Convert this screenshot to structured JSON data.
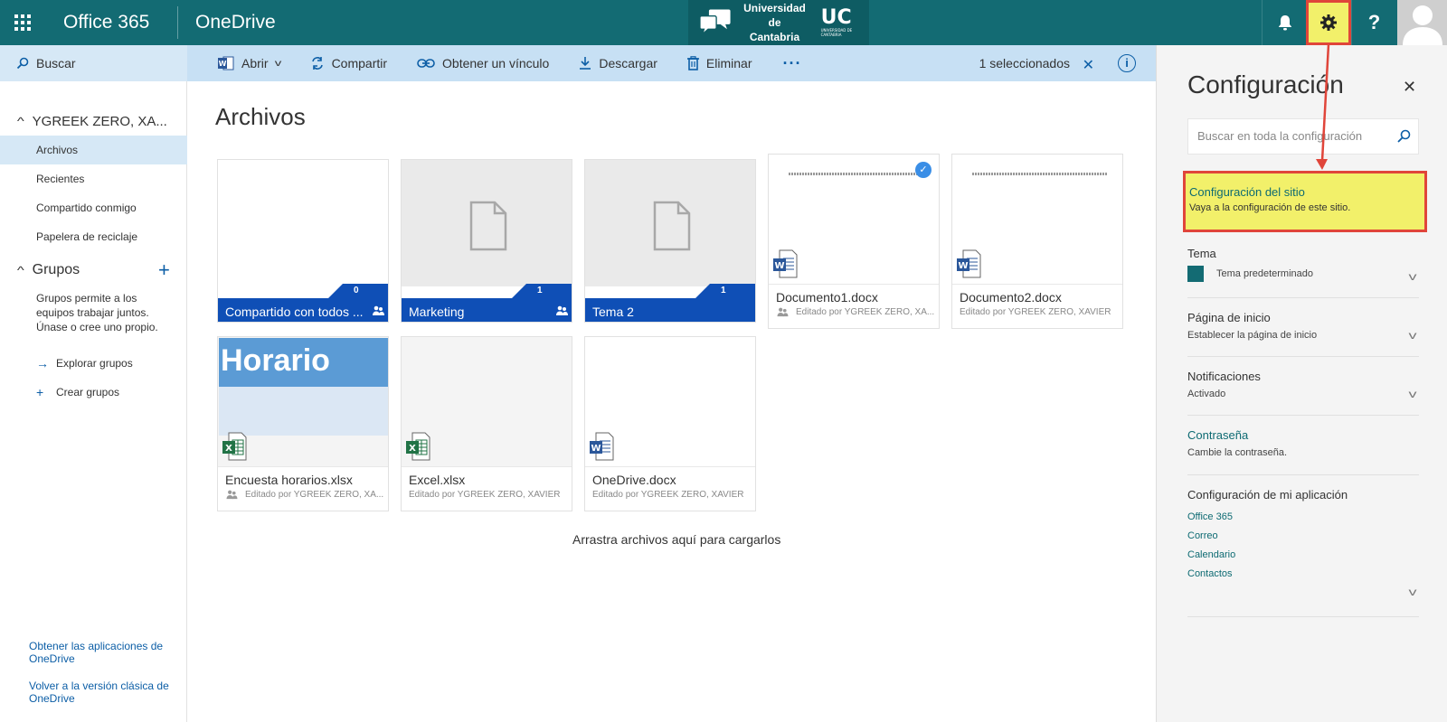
{
  "suite": {
    "brand": "Office 365",
    "app": "OneDrive",
    "university_line1": "Universidad de",
    "university_line2": "Cantabria",
    "uc_mark": "UC",
    "uc_small": "UNIVERSIDAD DE CANTABRIA"
  },
  "search": {
    "label": "Buscar"
  },
  "commands": {
    "open": "Abrir",
    "share": "Compartir",
    "get_link": "Obtener un vínculo",
    "download": "Descargar",
    "delete": "Eliminar",
    "more": "···",
    "selected": "1 seleccionados"
  },
  "nav": {
    "user": "YGREEK ZERO, XA...",
    "items": [
      "Archivos",
      "Recientes",
      "Compartido conmigo",
      "Papelera de reciclaje"
    ],
    "groups_title": "Grupos",
    "groups_desc": "Grupos permite a los equipos trabajar juntos. Únase o cree uno propio.",
    "explore_groups": "Explorar grupos",
    "create_groups": "Crear grupos",
    "footer_apps": "Obtener las aplicaciones de OneDrive",
    "footer_classic": "Volver a la versión clásica de OneDrive"
  },
  "main": {
    "title": "Archivos",
    "folders": [
      {
        "name": "Compartido con todos ...",
        "count": "0"
      },
      {
        "name": "Marketing",
        "count": "1"
      },
      {
        "name": "Tema 2",
        "count": "1"
      }
    ],
    "files": [
      {
        "name": "Documento1.docx",
        "meta": "Editado por YGREEK ZERO, XA..."
      },
      {
        "name": "Documento2.docx",
        "meta": "Editado por YGREEK ZERO, XAVIER"
      },
      {
        "name": "Encuesta horarios.xlsx",
        "meta": "Editado por YGREEK ZERO, XA...",
        "thumb_text": "Horario"
      },
      {
        "name": "Excel.xlsx",
        "meta": "Editado por YGREEK ZERO, XAVIER"
      },
      {
        "name": "OneDrive.docx",
        "meta": "Editado por YGREEK ZERO, XAVIER"
      }
    ],
    "drop_hint": "Arrastra archivos aquí para cargarlos"
  },
  "settings": {
    "title": "Configuración",
    "search_placeholder": "Buscar en toda la configuración",
    "site_title": "Configuración del sitio",
    "site_desc": "Vaya a la configuración de este sitio.",
    "theme_h": "Tema",
    "theme_v": "Tema predeterminado",
    "home_h": "Página de inicio",
    "home_v": "Establecer la página de inicio",
    "notif_h": "Notificaciones",
    "notif_v": "Activado",
    "pwd_h": "Contraseña",
    "pwd_v": "Cambie la contraseña.",
    "apps_h": "Configuración de mi aplicación",
    "apps": [
      "Office 365",
      "Correo",
      "Calendario",
      "Contactos"
    ]
  },
  "colors": {
    "suitebar": "#136b73",
    "folder": "#0f4fb6",
    "highlight": "#f2f06a",
    "annotation": "#e0453a"
  }
}
